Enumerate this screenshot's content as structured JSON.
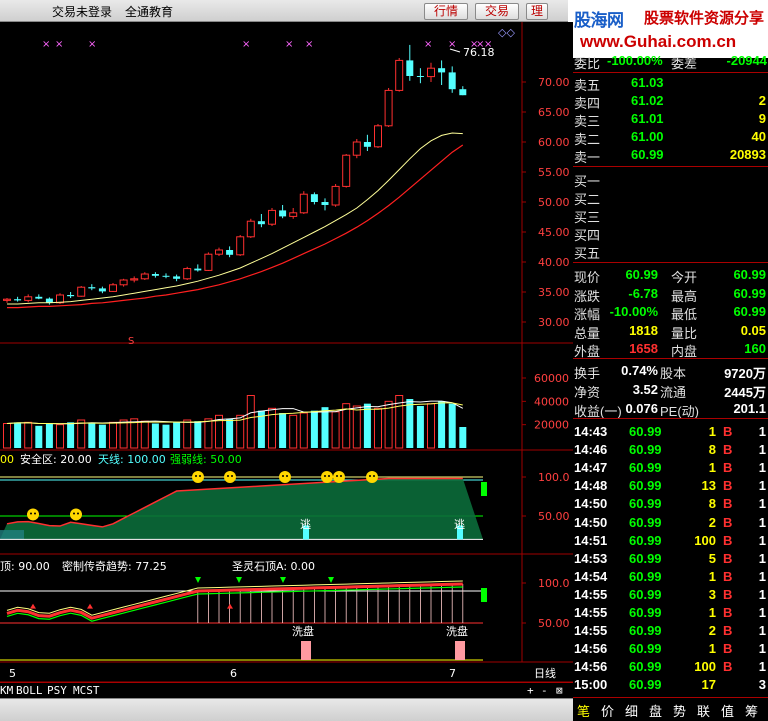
{
  "topbar": {
    "login_status": "交易未登录",
    "company": "全通教育",
    "btn_quote": "行情",
    "btn_trade": "交易",
    "btn_cut": "理"
  },
  "watermark": {
    "brand_a": "股海网",
    "brand_b": "股票软件资源分享",
    "url": "www.Guhai.com.cn"
  },
  "main_chart": {
    "last_high_label": "76.18",
    "price_ticks": [
      "70.00",
      "65.00",
      "60.00",
      "55.00",
      "50.00",
      "45.00",
      "40.00",
      "35.00",
      "30.00"
    ],
    "candles": [
      [
        33.6,
        34.0,
        33.2,
        33.8
      ],
      [
        33.8,
        34.2,
        33.4,
        33.6
      ],
      [
        33.6,
        34.6,
        33.3,
        34.2
      ],
      [
        34.2,
        34.6,
        33.8,
        33.9
      ],
      [
        33.9,
        34.1,
        32.9,
        33.2
      ],
      [
        33.2,
        34.8,
        33.0,
        34.5
      ],
      [
        34.5,
        35.0,
        34.0,
        34.3
      ],
      [
        34.3,
        36.0,
        34.2,
        35.8
      ],
      [
        35.8,
        36.3,
        35.3,
        35.6
      ],
      [
        35.6,
        35.9,
        34.8,
        35.1
      ],
      [
        35.1,
        36.5,
        35.0,
        36.2
      ],
      [
        36.2,
        37.2,
        35.9,
        37.0
      ],
      [
        37.0,
        37.6,
        36.6,
        37.2
      ],
      [
        37.2,
        38.3,
        37.0,
        38.0
      ],
      [
        38.0,
        38.3,
        37.4,
        37.7
      ],
      [
        37.7,
        38.1,
        37.3,
        37.6
      ],
      [
        37.6,
        37.9,
        36.8,
        37.2
      ],
      [
        37.2,
        39.2,
        37.0,
        38.9
      ],
      [
        38.9,
        39.6,
        38.4,
        38.6
      ],
      [
        38.6,
        41.6,
        38.5,
        41.3
      ],
      [
        41.3,
        42.4,
        41.0,
        42.0
      ],
      [
        42.0,
        42.6,
        40.8,
        41.2
      ],
      [
        41.2,
        44.5,
        41.0,
        44.2
      ],
      [
        44.2,
        47.2,
        44.0,
        46.8
      ],
      [
        46.8,
        48.0,
        45.8,
        46.3
      ],
      [
        46.3,
        49.0,
        46.0,
        48.6
      ],
      [
        48.6,
        49.5,
        47.3,
        47.6
      ],
      [
        47.6,
        49.0,
        47.2,
        48.2
      ],
      [
        48.2,
        51.8,
        48.0,
        51.3
      ],
      [
        51.3,
        51.6,
        49.6,
        50.0
      ],
      [
        50.0,
        50.6,
        48.6,
        49.5
      ],
      [
        49.5,
        53.0,
        49.2,
        52.6
      ],
      [
        52.6,
        58.0,
        52.4,
        57.8
      ],
      [
        57.8,
        60.5,
        57.3,
        60.0
      ],
      [
        60.0,
        61.2,
        58.5,
        59.2
      ],
      [
        59.2,
        63.0,
        59.0,
        62.7
      ],
      [
        62.7,
        69.0,
        62.5,
        68.6
      ],
      [
        68.6,
        74.0,
        68.4,
        73.6
      ],
      [
        73.6,
        76.18,
        70.2,
        71.0
      ],
      [
        71.0,
        72.3,
        69.8,
        70.9
      ],
      [
        70.9,
        73.2,
        70.0,
        72.3
      ],
      [
        72.3,
        73.6,
        69.5,
        71.6
      ],
      [
        71.6,
        72.6,
        68.2,
        68.8
      ],
      [
        68.8,
        69.3,
        67.8,
        67.8
      ]
    ],
    "ma_fast": [
      33.0,
      33.0,
      33.1,
      33.2,
      33.2,
      33.3,
      33.4,
      33.6,
      33.8,
      34.0,
      34.2,
      34.5,
      34.8,
      35.1,
      35.4,
      35.7,
      36.0,
      36.4,
      36.8,
      37.3,
      37.8,
      38.4,
      39.0,
      39.8,
      40.6,
      41.4,
      42.3,
      43.2,
      44.1,
      45.0,
      45.9,
      46.9,
      47.9,
      49.0,
      50.4,
      51.9,
      53.6,
      55.4,
      57.2,
      58.9,
      60.2,
      61.1,
      61.5,
      61.4
    ],
    "ma_slow": [
      32.4,
      32.4,
      32.5,
      32.6,
      32.6,
      32.7,
      32.8,
      32.9,
      33.1,
      33.2,
      33.4,
      33.6,
      33.8,
      34.0,
      34.3,
      34.5,
      34.8,
      35.1,
      35.4,
      35.8,
      36.2,
      36.7,
      37.2,
      37.8,
      38.4,
      39.1,
      39.8,
      40.6,
      41.4,
      42.2,
      43.0,
      43.9,
      44.8,
      45.8,
      46.9,
      48.1,
      49.4,
      50.8,
      52.3,
      53.8,
      55.3,
      56.8,
      58.3,
      59.5
    ],
    "top_markers": [
      "×",
      "×",
      "×",
      "×",
      "×",
      "×",
      "×",
      "×",
      "×",
      "×",
      "×"
    ]
  },
  "volume": {
    "ticks": [
      "60000",
      "40000",
      "20000"
    ],
    "bars": [
      21000,
      22000,
      22000,
      19000,
      21000,
      20000,
      22000,
      24000,
      21000,
      20000,
      22000,
      24000,
      25000,
      23000,
      21000,
      20000,
      22000,
      24000,
      23000,
      25000,
      28000,
      25000,
      28000,
      45000,
      32000,
      34000,
      30000,
      28000,
      30000,
      32000,
      35000,
      31000,
      38000,
      36000,
      38000,
      34000,
      40000,
      45000,
      42000,
      36000,
      38000,
      40000,
      38000,
      18000
    ]
  },
  "indicator1": {
    "label_prefix": "00",
    "safe_zone": "安全区: 20.00",
    "sky_line": "天线: 100.00",
    "strength_line": "强弱线: 50.00",
    "ticks": [
      "100.0",
      "50.00"
    ],
    "escape_label": "逃"
  },
  "indicator2": {
    "label_a": "顶: 90.00",
    "label_b": "密制传奇趋势: 77.25",
    "label_c": "圣灵石顶A: 0.00",
    "ticks": [
      "100.0",
      "50.00"
    ],
    "wash_label": "洗盘"
  },
  "date_axis": {
    "labels": [
      "5",
      "6",
      "7"
    ],
    "period": "日线"
  },
  "indicator_tabs": [
    "KM",
    "BOLL",
    "PSY",
    "MCST"
  ],
  "axis_controls": {
    "plus": "+",
    "minus": "-",
    "expand": "⊠"
  },
  "quote": {
    "weibi_label": "委比",
    "weibi_value": "-100.00%",
    "weicha_label": "委差",
    "weicha_value": "-20944",
    "asks": [
      {
        "label": "卖五",
        "price": "61.03",
        "vol": ""
      },
      {
        "label": "卖四",
        "price": "61.02",
        "vol": "2"
      },
      {
        "label": "卖三",
        "price": "61.01",
        "vol": "9"
      },
      {
        "label": "卖二",
        "price": "61.00",
        "vol": "40"
      },
      {
        "label": "卖一",
        "price": "60.99",
        "vol": "20893"
      }
    ],
    "bids": [
      {
        "label": "买一"
      },
      {
        "label": "买二"
      },
      {
        "label": "买三"
      },
      {
        "label": "买四"
      },
      {
        "label": "买五"
      }
    ],
    "stats": [
      {
        "l1": "现价",
        "v1": "60.99",
        "c1": "gr",
        "l2": "今开",
        "v2": "60.99",
        "c2": "gr"
      },
      {
        "l1": "涨跌",
        "v1": "-6.78",
        "c1": "gr",
        "l2": "最高",
        "v2": "60.99",
        "c2": "gr"
      },
      {
        "l1": "涨幅",
        "v1": "-10.00%",
        "c1": "gr",
        "l2": "最低",
        "v2": "60.99",
        "c2": "gr"
      },
      {
        "l1": "总量",
        "v1": "1818",
        "c1": "yl",
        "l2": "量比",
        "v2": "0.05",
        "c2": "yl"
      },
      {
        "l1": "外盘",
        "v1": "1658",
        "c1": "rd",
        "l2": "内盘",
        "v2": "160",
        "c2": "gr"
      }
    ],
    "fund": [
      {
        "l1": "换手",
        "v1": "0.74%",
        "l2": "股本",
        "v2": "9720万"
      },
      {
        "l1": "净资",
        "v1": "3.52",
        "l2": "流通",
        "v2": "2445万"
      },
      {
        "l1": "收益(一)",
        "v1": "0.076",
        "l2": "PE(动)",
        "v2": "201.1"
      }
    ],
    "ticks": [
      {
        "t": "14:43",
        "p": "60.99",
        "v": "1",
        "b": "B",
        "n": "1"
      },
      {
        "t": "14:46",
        "p": "60.99",
        "v": "8",
        "b": "B",
        "n": "1"
      },
      {
        "t": "14:47",
        "p": "60.99",
        "v": "1",
        "b": "B",
        "n": "1"
      },
      {
        "t": "14:48",
        "p": "60.99",
        "v": "13",
        "b": "B",
        "n": "1"
      },
      {
        "t": "14:50",
        "p": "60.99",
        "v": "8",
        "b": "B",
        "n": "1"
      },
      {
        "t": "14:50",
        "p": "60.99",
        "v": "2",
        "b": "B",
        "n": "1"
      },
      {
        "t": "14:51",
        "p": "60.99",
        "v": "100",
        "b": "B",
        "n": "1"
      },
      {
        "t": "14:53",
        "p": "60.99",
        "v": "5",
        "b": "B",
        "n": "1"
      },
      {
        "t": "14:54",
        "p": "60.99",
        "v": "1",
        "b": "B",
        "n": "1"
      },
      {
        "t": "14:55",
        "p": "60.99",
        "v": "3",
        "b": "B",
        "n": "1"
      },
      {
        "t": "14:55",
        "p": "60.99",
        "v": "1",
        "b": "B",
        "n": "1"
      },
      {
        "t": "14:55",
        "p": "60.99",
        "v": "2",
        "b": "B",
        "n": "1"
      },
      {
        "t": "14:56",
        "p": "60.99",
        "v": "1",
        "b": "B",
        "n": "1"
      },
      {
        "t": "14:56",
        "p": "60.99",
        "v": "100",
        "b": "B",
        "n": "1"
      },
      {
        "t": "15:00",
        "p": "60.99",
        "v": "17",
        "b": "",
        "n": "3"
      }
    ]
  },
  "bottom_tabs": [
    "笔",
    "价",
    "细",
    "盘",
    "势",
    "联",
    "值",
    "筹"
  ],
  "colors": {
    "up": "#ff3030",
    "down": "#54ffff",
    "ma_fast": "#ffff99",
    "ma_slow": "#ff2020",
    "grid": "#a00000"
  }
}
